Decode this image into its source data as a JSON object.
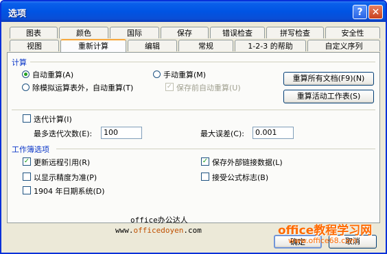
{
  "window": {
    "title": "选项",
    "help_glyph": "?",
    "close_glyph": "✕"
  },
  "tabs_row1": [
    "图表",
    "颜色",
    "国际",
    "保存",
    "错误检查",
    "拼写检查",
    "安全性"
  ],
  "tabs_row2": [
    "视图",
    "重新计算",
    "编辑",
    "常规",
    "1-2-3 的帮助",
    "自定义序列"
  ],
  "active_tab": "重新计算",
  "calc": {
    "group_title": "计算",
    "auto_recalc": "自动重算(A)",
    "auto_except_tables": "除模拟运算表外，自动重算(T)",
    "manual_recalc": "手动重算(M)",
    "save_before_recalc": "保存前自动重算(U)",
    "recalc_all_button": "重算所有文档(F9)(N)",
    "recalc_sheet_button": "重算活动工作表(S)",
    "iteration": "迭代计算(I)",
    "max_iterations_label": "最多迭代次数(E):",
    "max_iterations_value": "100",
    "max_change_label": "最大误差(C):",
    "max_change_value": "0.001"
  },
  "workbook": {
    "group_title": "工作簿选项",
    "update_remote": "更新远程引用(R)",
    "precision_as_displayed": "以显示精度为准(P)",
    "date_1904": "1904 年日期系统(D)",
    "save_external_links": "保存外部链接数据(L)",
    "accept_labels": "接受公式标志(B)"
  },
  "footer": {
    "ok_button": "确定",
    "cancel_button": "取消"
  },
  "watermarks": {
    "line1": "office办公达人",
    "line2_prefix": "www.",
    "line2_highlight": "officedoyen",
    "line2_suffix": ".com",
    "brand": "office教程学习网",
    "brand_url": "www.office68.com"
  },
  "colors": {
    "titlebar": "#0054e3",
    "accent_tab": "#f7a63a",
    "group_title": "#0a36c8",
    "check_mark": "#21a121",
    "watermark": "#ff6a00"
  }
}
